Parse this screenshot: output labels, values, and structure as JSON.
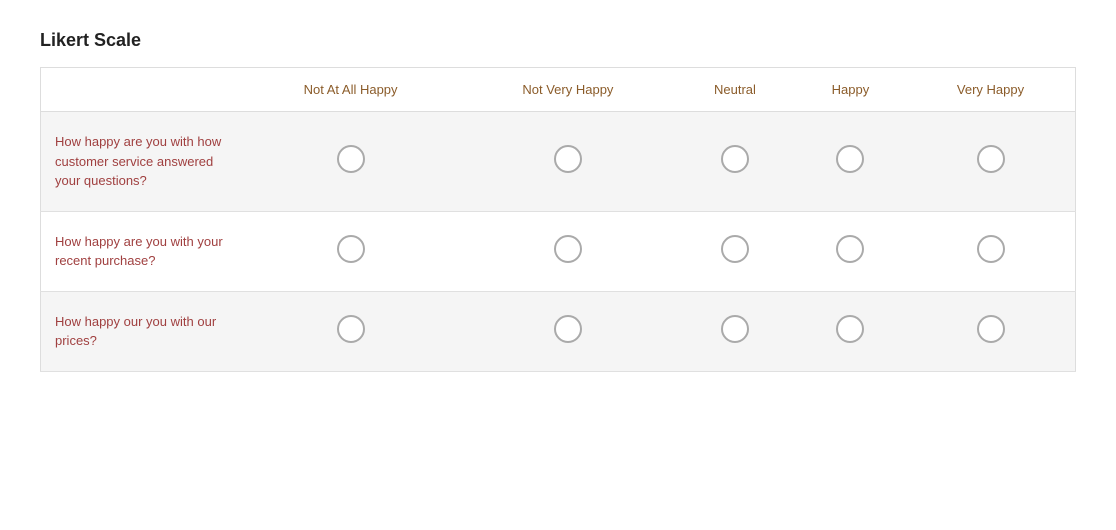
{
  "title": "Likert Scale",
  "columns": [
    {
      "label": "",
      "key": "question"
    },
    {
      "label": "Not At All Happy",
      "key": "col1"
    },
    {
      "label": "Not Very Happy",
      "key": "col2"
    },
    {
      "label": "Neutral",
      "key": "col3"
    },
    {
      "label": "Happy",
      "key": "col4"
    },
    {
      "label": "Very Happy",
      "key": "col5"
    }
  ],
  "rows": [
    {
      "question": "How happy are you with how customer service answered your questions?",
      "options": [
        false,
        false,
        false,
        false,
        false
      ]
    },
    {
      "question": "How happy are you with your recent purchase?",
      "options": [
        false,
        false,
        false,
        false,
        false
      ]
    },
    {
      "question": "How happy our you with our prices?",
      "options": [
        false,
        false,
        false,
        false,
        false
      ]
    }
  ]
}
